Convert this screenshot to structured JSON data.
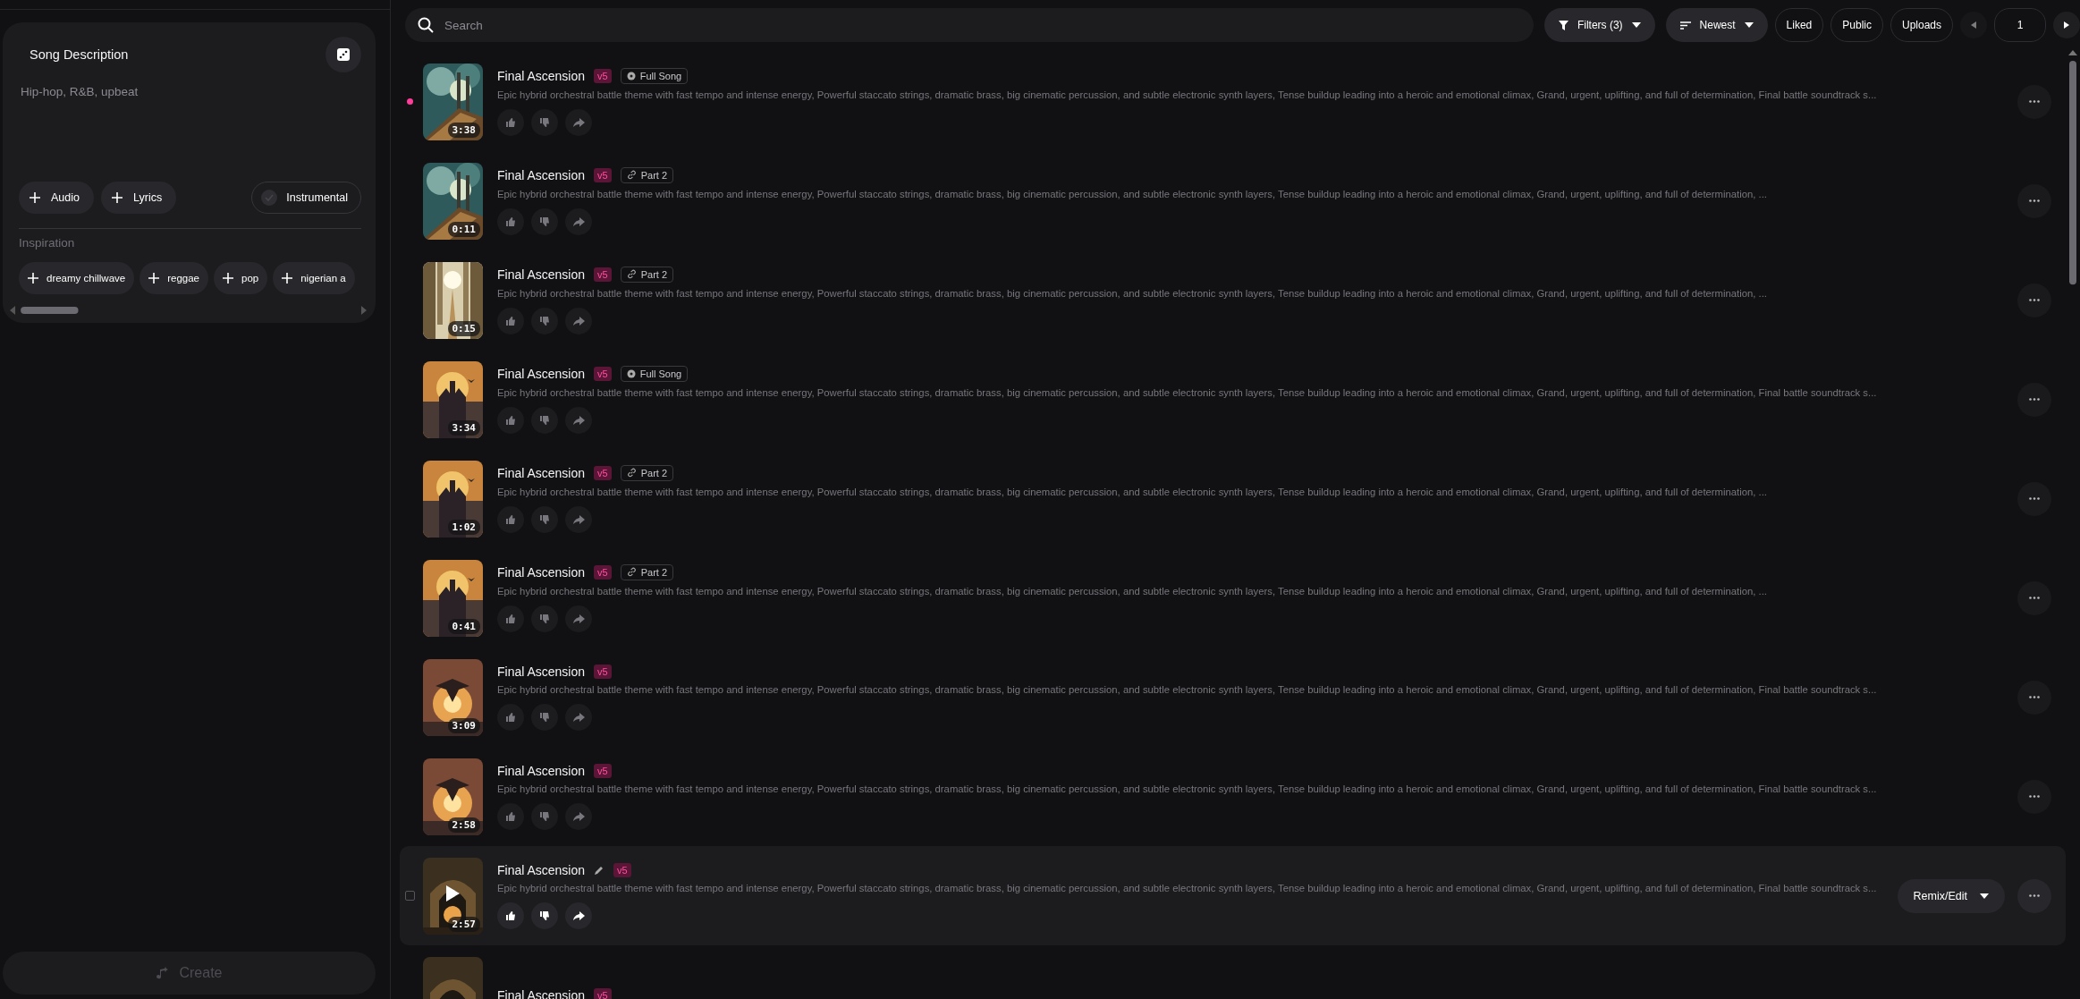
{
  "sidebar": {
    "card": {
      "title": "Song Description",
      "placeholder": "Hip-hop, R&B, upbeat",
      "add_buttons": [
        "Audio",
        "Lyrics"
      ],
      "instrumental": {
        "label": "Instrumental",
        "checked": false
      },
      "inspiration": {
        "label": "Inspiration",
        "chips": [
          "dreamy chillwave",
          "reggae",
          "pop",
          "nigerian a"
        ]
      }
    },
    "create": {
      "label": "Create",
      "disabled": true
    }
  },
  "toolbar": {
    "search": {
      "placeholder": "Search"
    },
    "filters": "Filters (3)",
    "sort": "Newest",
    "toggles": [
      {
        "label": "Liked",
        "selected": false
      },
      {
        "label": "Public",
        "selected": false
      },
      {
        "label": "Uploads",
        "selected": false
      }
    ],
    "pager": {
      "prev_disabled": true,
      "page": "1"
    }
  },
  "songs": [
    {
      "title": "Final Ascension",
      "version": "v5",
      "tag": {
        "kind": "full_song",
        "label": "Full Song"
      },
      "description": "Epic hybrid orchestral battle theme with fast tempo and intense energy, Powerful staccato strings, dramatic brass, big cinematic percussion, and subtle electronic synth layers, Tense buildup leading into a heroic and emotional climax, Grand, urgent, uplifting, and full of determination, Final battle soundtrack s...",
      "duration": "3:38",
      "unplayed": true,
      "hovered": false
    },
    {
      "title": "Final Ascension",
      "version": "v5",
      "tag": {
        "kind": "part",
        "label": "Part 2"
      },
      "description": "Epic hybrid orchestral battle theme with fast tempo and intense energy, Powerful staccato strings, dramatic brass, big cinematic percussion, and subtle electronic synth layers, Tense buildup leading into a heroic and emotional climax, Grand, urgent, uplifting, and full of determination, ...",
      "duration": "0:11",
      "unplayed": false,
      "hovered": false
    },
    {
      "title": "Final Ascension",
      "version": "v5",
      "tag": {
        "kind": "part",
        "label": "Part 2"
      },
      "description": "Epic hybrid orchestral battle theme with fast tempo and intense energy, Powerful staccato strings, dramatic brass, big cinematic percussion, and subtle electronic synth layers, Tense buildup leading into a heroic and emotional climax, Grand, urgent, uplifting, and full of determination, ...",
      "duration": "0:15",
      "unplayed": false,
      "hovered": false
    },
    {
      "title": "Final Ascension",
      "version": "v5",
      "tag": {
        "kind": "full_song",
        "label": "Full Song"
      },
      "description": "Epic hybrid orchestral battle theme with fast tempo and intense energy, Powerful staccato strings, dramatic brass, big cinematic percussion, and subtle electronic synth layers, Tense buildup leading into a heroic and emotional climax, Grand, urgent, uplifting, and full of determination, Final battle soundtrack s...",
      "duration": "3:34",
      "unplayed": false,
      "hovered": false
    },
    {
      "title": "Final Ascension",
      "version": "v5",
      "tag": {
        "kind": "part",
        "label": "Part 2"
      },
      "description": "Epic hybrid orchestral battle theme with fast tempo and intense energy, Powerful staccato strings, dramatic brass, big cinematic percussion, and subtle electronic synth layers, Tense buildup leading into a heroic and emotional climax, Grand, urgent, uplifting, and full of determination, ...",
      "duration": "1:02",
      "unplayed": false,
      "hovered": false
    },
    {
      "title": "Final Ascension",
      "version": "v5",
      "tag": {
        "kind": "part",
        "label": "Part 2"
      },
      "description": "Epic hybrid orchestral battle theme with fast tempo and intense energy, Powerful staccato strings, dramatic brass, big cinematic percussion, and subtle electronic synth layers, Tense buildup leading into a heroic and emotional climax, Grand, urgent, uplifting, and full of determination, ...",
      "duration": "0:41",
      "unplayed": false,
      "hovered": false
    },
    {
      "title": "Final Ascension",
      "version": "v5",
      "description": "Epic hybrid orchestral battle theme with fast tempo and intense energy, Powerful staccato strings, dramatic brass, big cinematic percussion, and subtle electronic synth layers, Tense buildup leading into a heroic and emotional climax, Grand, urgent, uplifting, and full of determination, Final battle soundtrack s...",
      "duration": "3:09",
      "unplayed": false,
      "hovered": false
    },
    {
      "title": "Final Ascension",
      "version": "v5",
      "description": "Epic hybrid orchestral battle theme with fast tempo and intense energy, Powerful staccato strings, dramatic brass, big cinematic percussion, and subtle electronic synth layers, Tense buildup leading into a heroic and emotional climax, Grand, urgent, uplifting, and full of determination, Final battle soundtrack s...",
      "duration": "2:58",
      "unplayed": false,
      "hovered": false
    },
    {
      "title": "Final Ascension",
      "version": "v5",
      "description": "Epic hybrid orchestral battle theme with fast tempo and intense energy, Powerful staccato strings, dramatic brass, big cinematic percussion, and subtle electronic synth layers, Tense buildup leading into a heroic and emotional climax, Grand, urgent, uplifting, and full of determination, Final battle soundtrack s...",
      "duration": "2:57",
      "unplayed": false,
      "hovered": true,
      "remix": "Remix/Edit"
    },
    {
      "title": "Final Ascension",
      "version": "v5",
      "unplayed": false,
      "hovered": false
    }
  ]
}
